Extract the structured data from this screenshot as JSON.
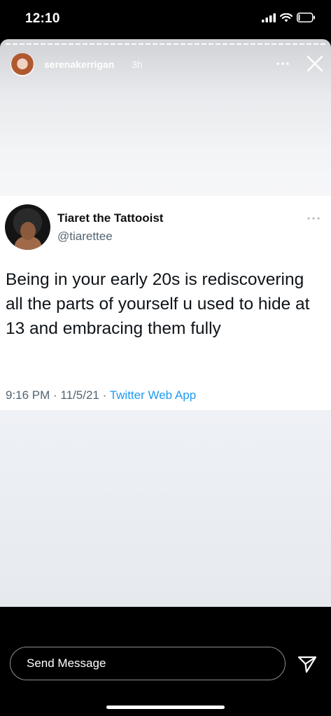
{
  "status_bar": {
    "time": "12:10"
  },
  "story": {
    "username": "serenakerrigan",
    "time_ago": "3h"
  },
  "tweet": {
    "author_name": "Tiaret the Tattooist",
    "handle": "@tiarettee",
    "text": "Being in your early 20s is rediscovering all the parts of yourself u used to hide at 13 and embracing them fully",
    "time": "9:16 PM",
    "separator": " · ",
    "date": "11/5/21",
    "source": "Twitter Web App"
  },
  "reply": {
    "placeholder": "Send Message"
  },
  "icons": {
    "signal": "signal-icon",
    "wifi": "wifi-icon",
    "battery": "battery-icon",
    "more": "more-icon",
    "close": "close-icon",
    "send": "send-icon"
  }
}
